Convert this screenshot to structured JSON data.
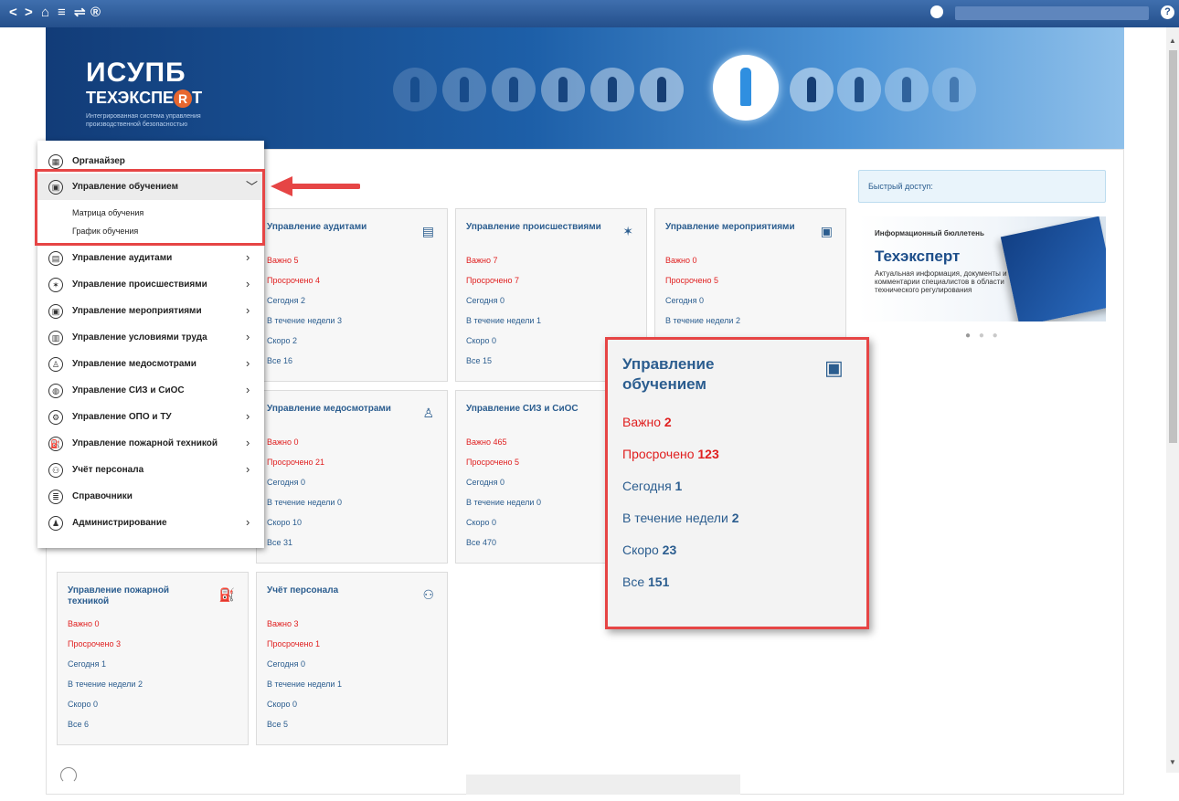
{
  "toolbar": {
    "icons": [
      "back-icon",
      "forward-icon",
      "home-icon",
      "menu-icon",
      "filter-icon",
      "registered-icon",
      "user-icon",
      "help-icon"
    ],
    "help": "?"
  },
  "header": {
    "logo_title": "ИСУПБ",
    "logo_sub_a": "ТЕХЭКСПЕ",
    "logo_sub_r": "R",
    "logo_sub_b": "Т",
    "logo_desc": "Интегрированная система управления производственной безопасностью"
  },
  "menu": {
    "items": [
      {
        "label": "Органайзер",
        "icon": "organizer-icon",
        "arrow": ""
      },
      {
        "label": "Управление обучением",
        "icon": "training-icon",
        "arrow": "﹀"
      },
      {
        "label": "Управление аудитами",
        "icon": "audit-icon",
        "arrow": "›"
      },
      {
        "label": "Управление происшествиями",
        "icon": "incident-icon",
        "arrow": "›"
      },
      {
        "label": "Управление мероприятиями",
        "icon": "events-icon",
        "arrow": "›"
      },
      {
        "label": "Управление условиями труда",
        "icon": "work-conditions-icon",
        "arrow": "›"
      },
      {
        "label": "Управление медосмотрами",
        "icon": "medical-icon",
        "arrow": "›"
      },
      {
        "label": "Управление СИЗ и СиОС",
        "icon": "ppe-icon",
        "arrow": "›"
      },
      {
        "label": "Управление ОПО и ТУ",
        "icon": "opo-icon",
        "arrow": "›"
      },
      {
        "label": "Управление пожарной техникой",
        "icon": "fire-icon",
        "arrow": "›"
      },
      {
        "label": "Учёт персонала",
        "icon": "staff-icon",
        "arrow": "›"
      },
      {
        "label": "Справочники",
        "icon": "reference-icon",
        "arrow": ""
      },
      {
        "label": "Администрирование",
        "icon": "admin-icon",
        "arrow": "›"
      }
    ],
    "submenu": [
      "Матрица обучения",
      "График обучения"
    ]
  },
  "cards": [
    {
      "title": "Управление аудитами",
      "rows": [
        "Важно 5",
        "Просрочено 4",
        "Сегодня 2",
        "В течение недели 3",
        "Скоро 2",
        "Все 16"
      ]
    },
    {
      "title": "Управление происшествиями",
      "rows": [
        "Важно 7",
        "Просрочено 7",
        "Сегодня 0",
        "В течение недели 1",
        "Скоро 0",
        "Все 15"
      ]
    },
    {
      "title": "Управление мероприятиями",
      "rows": [
        "Важно 0",
        "Просрочено 5",
        "Сегодня 0",
        "В течение недели 2"
      ]
    },
    {
      "title": "Управление медосмотрами",
      "rows": [
        "Важно 0",
        "Просрочено 21",
        "Сегодня 0",
        "В течение недели 0",
        "Скоро 10",
        "Все 31"
      ]
    },
    {
      "title": "Управление СИЗ и СиОС",
      "rows": [
        "Важно 465",
        "Просрочено 5",
        "Сегодня 0",
        "В течение недели 0",
        "Скоро 0",
        "Все 470"
      ]
    },
    {
      "title": "Управление пожарной техникой",
      "rows": [
        "Важно 0",
        "Просрочено 3",
        "Сегодня 1",
        "В течение недели 2",
        "Скоро 0",
        "Все 6"
      ]
    },
    {
      "title": "Учёт персонала",
      "rows": [
        "Важно 3",
        "Просрочено 1",
        "Сегодня 0",
        "В течение недели 1",
        "Скоро 0",
        "Все 5"
      ]
    }
  ],
  "quick_access": "Быстрый доступ:",
  "promo": {
    "line1": "Информационный бюллетень",
    "brand": "Техэксперт",
    "text": "Актуальная информация, документы и комментарии специалистов в области технического регулирования"
  },
  "zoom_card": {
    "title": "Управление обучением",
    "rows": [
      {
        "label": "Важно",
        "value": "2",
        "red": true
      },
      {
        "label": "Просрочено",
        "value": "123",
        "red": true
      },
      {
        "label": "Сегодня",
        "value": "1",
        "red": false
      },
      {
        "label": "В течение недели",
        "value": "2",
        "red": false
      },
      {
        "label": "Скоро",
        "value": "23",
        "red": false
      },
      {
        "label": "Все",
        "value": "151",
        "red": false
      }
    ]
  },
  "colors": {
    "accent": "#2b5d8f",
    "alert": "#e02020",
    "highlight": "#e64545",
    "toolbar": "#244f8b"
  }
}
